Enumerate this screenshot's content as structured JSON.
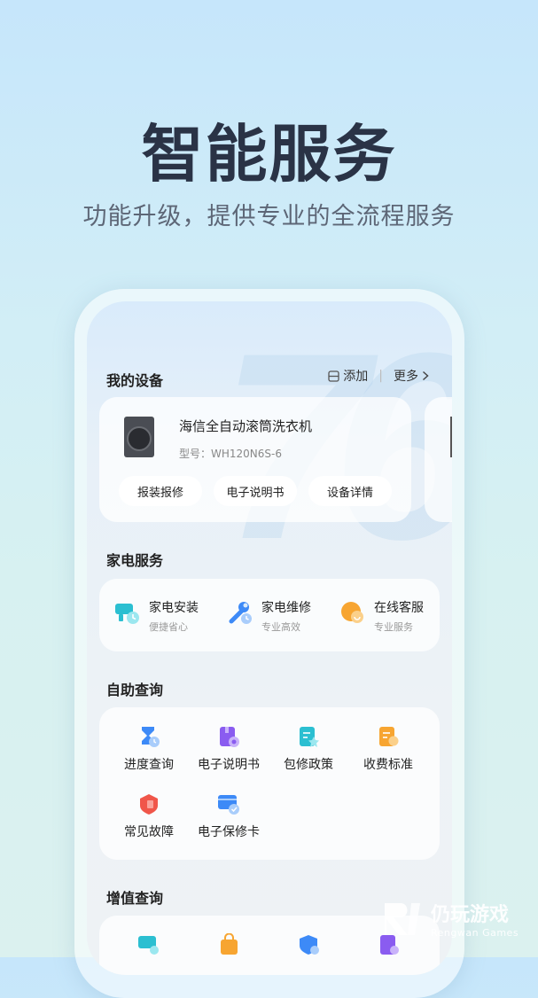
{
  "hero": {
    "title": "智能服务",
    "subtitle": "功能升级，提供专业的全流程服务"
  },
  "devices": {
    "section_title": "我的设备",
    "add_label": "添加",
    "more_label": "更多",
    "device": {
      "name": "海信全自动滚筒洗衣机",
      "model": "型号：WH120N6S-6"
    },
    "actions": [
      "报装报修",
      "电子说明书",
      "设备详情"
    ]
  },
  "appliance_services": {
    "section_title": "家电服务",
    "items": [
      {
        "title": "家电安装",
        "desc": "便捷省心",
        "icon": "install-icon"
      },
      {
        "title": "家电维修",
        "desc": "专业高效",
        "icon": "repair-wrench-icon"
      },
      {
        "title": "在线客服",
        "desc": "专业服务",
        "icon": "customer-service-icon"
      }
    ]
  },
  "self_query": {
    "section_title": "自助查询",
    "items": [
      {
        "label": "进度查询",
        "icon": "hourglass-icon"
      },
      {
        "label": "电子说明书",
        "icon": "manual-book-icon"
      },
      {
        "label": "包修政策",
        "icon": "policy-doc-icon"
      },
      {
        "label": "收费标准",
        "icon": "fee-doc-icon"
      },
      {
        "label": "常见故障",
        "icon": "fault-shield-icon"
      },
      {
        "label": "电子保修卡",
        "icon": "warranty-card-icon"
      }
    ]
  },
  "value_query": {
    "section_title": "增值查询"
  },
  "watermark": {
    "main": "仍玩游戏",
    "sub": "Rengwan Games"
  },
  "colors": {
    "title": "#2a3346",
    "subtitle": "#5d6676",
    "teal": "#2bbfd1",
    "blue": "#3d8af7",
    "orange": "#f7a531",
    "purple": "#8a5cf0",
    "red": "#f0564a"
  }
}
